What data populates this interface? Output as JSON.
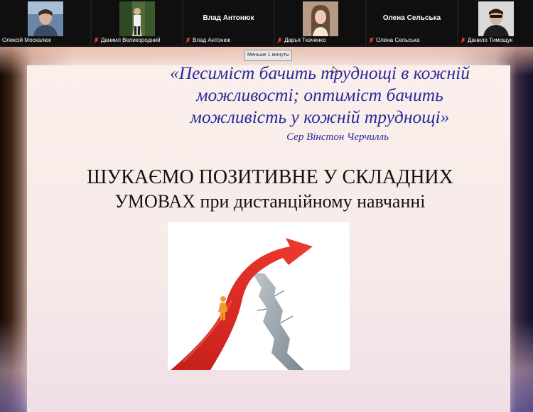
{
  "participants": [
    {
      "name": "Олексій Москалюк",
      "muted": false,
      "has_video": true
    },
    {
      "name": "Даниил Великородний",
      "muted": true,
      "has_video": true
    },
    {
      "name": "Влад Антонюк",
      "muted": true,
      "has_video": false,
      "display_name": "Влад Антонюк"
    },
    {
      "name": "Дарья Ткаченко",
      "muted": true,
      "has_video": true
    },
    {
      "name": "Олена Сельська",
      "muted": true,
      "has_video": false,
      "display_name": "Олена Сельська"
    },
    {
      "name": "Данило Тимощук",
      "muted": true,
      "has_video": true
    }
  ],
  "tooltip": "Меньше 1 минуты",
  "slide": {
    "quote_lines": [
      "«Песиміст бачить труднощі в кожній",
      "можливості; оптиміст бачить",
      "можливість у кожній труднощі»"
    ],
    "author": "Сер Вінстон Черчилль",
    "headline_upper": "ШУКАЄМО ПОЗИТИВНЕ У СКЛАДНИХ",
    "headline_caps": "УМОВАХ",
    "headline_rest": " при дистанційному навчанні"
  },
  "colors": {
    "quote": "#2a2a9a",
    "arrow": "#e8312b",
    "muted_icon": "#e53935"
  }
}
